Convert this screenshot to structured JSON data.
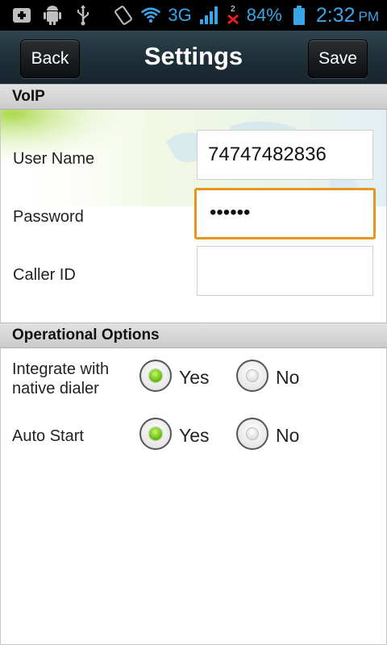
{
  "status_bar": {
    "network": "3G",
    "notification_count": "2",
    "battery": "84%",
    "time": "2:32",
    "ampm": "PM",
    "icons": [
      "add-icon",
      "android-debug-icon",
      "usb-icon",
      "vibrate-icon",
      "wifi-icon",
      "signal-icon",
      "missed-call-icon",
      "battery-icon"
    ]
  },
  "header": {
    "back_label": "Back",
    "title": "Settings",
    "save_label": "Save"
  },
  "voip": {
    "section_title": "VoIP",
    "fields": [
      {
        "label": "User Name",
        "value": "74747482836"
      },
      {
        "label": "Password",
        "value": "••••••"
      },
      {
        "label": "Caller ID",
        "value": ""
      }
    ]
  },
  "options": {
    "section_title": "Operational Options",
    "items": [
      {
        "label_line1": "Integrate with",
        "label_line2": "native dialer",
        "yes": "Yes",
        "no": "No",
        "selected": "Yes"
      },
      {
        "label_line1": "Auto Start",
        "label_line2": "",
        "yes": "Yes",
        "no": "No",
        "selected": "Yes"
      }
    ]
  },
  "colors": {
    "focus_border": "#e6951f",
    "radio_selected": "#6cc018",
    "status_icon": "#3aa6e8"
  }
}
